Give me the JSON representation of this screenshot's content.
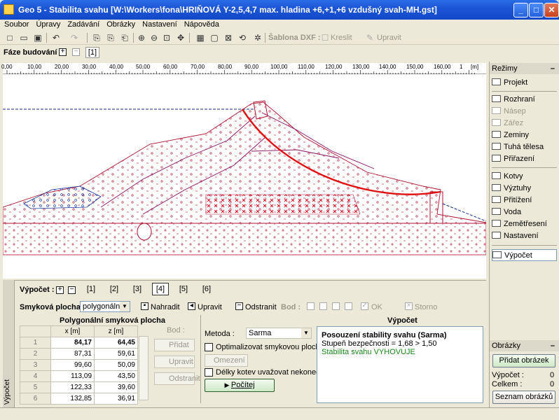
{
  "window": {
    "title": "Geo 5 - Stabilita svahu [W:\\Workers\\fona\\HRIŇOVÁ Y-2,5,4,7 max. hladina +6,+1,+6 vzdušný svah-MH.gst]",
    "controls": [
      "_",
      "□",
      "✕"
    ]
  },
  "menu": [
    "Soubor",
    "Úpravy",
    "Zadávání",
    "Obrázky",
    "Nastavení",
    "Nápověda"
  ],
  "toolbar": {
    "template_label": "Šablona DXF :",
    "draw_label": "Kreslit",
    "edit_label": "Upravit"
  },
  "phase": {
    "label": "Fáze budování :",
    "tab": "[1]"
  },
  "ruler": {
    "ticks": [
      "0,00",
      "10,00",
      "20,00",
      "30,00",
      "40,00",
      "50,00",
      "60,00",
      "70,00",
      "80,00",
      "90,00",
      "100,00",
      "110,00",
      "120,00",
      "130,00",
      "140,00",
      "150,00",
      "160,00",
      "1"
    ],
    "unit": "[m]"
  },
  "calc": {
    "label": "Výpočet :",
    "tabs": [
      "[1]",
      "[2]",
      "[3]",
      "[4]",
      "[5]",
      "[6]"
    ],
    "selected_tab": "[4]",
    "surface_label": "Smyková plocha :",
    "surface_value": "polygonální",
    "buttons": {
      "replace": "Nahradit",
      "edit": "Upravit",
      "remove": "Odstranit"
    },
    "bod_label": "Bod :",
    "ok_label": "OK",
    "cancel_label": "Storno",
    "side_tab": "Výpočet"
  },
  "polygon": {
    "title": "Polygonální smyková plocha",
    "col_x": "x [m]",
    "col_z": "z [m]",
    "rows": [
      {
        "i": "1",
        "x": "84,17",
        "z": "64,45"
      },
      {
        "i": "2",
        "x": "87,31",
        "z": "59,61"
      },
      {
        "i": "3",
        "x": "99,60",
        "z": "50,09"
      },
      {
        "i": "4",
        "x": "113,09",
        "z": "43,50"
      },
      {
        "i": "5",
        "x": "122,33",
        "z": "39,60"
      },
      {
        "i": "6",
        "x": "132,85",
        "z": "36,91"
      }
    ],
    "bod_label": "Bod :",
    "add": "Přidat",
    "edit": "Upravit",
    "remove": "Odstranit"
  },
  "method": {
    "label": "Metoda :",
    "value": "Sarma",
    "optimize": "Optimalizovat smykovou plochu",
    "limits": "Omezení",
    "anchors": "Délky kotev uvažovat nekonečné",
    "compute": "Počítej"
  },
  "result": {
    "header": "Výpočet",
    "title": "Posouzení stability svahu (Sarma)",
    "factor": "Stupeň bezpečnosti = 1,68 > 1,50",
    "verdict": "Stabilita svahu VYHOVUJE"
  },
  "modes": {
    "header": "Režimy",
    "items": [
      {
        "label": "Projekt",
        "state": "normal"
      },
      {
        "label": "Rozhraní",
        "state": "normal"
      },
      {
        "label": "Násep",
        "state": "disabled"
      },
      {
        "label": "Zářez",
        "state": "disabled"
      },
      {
        "label": "Zeminy",
        "state": "normal"
      },
      {
        "label": "Tuhá tělesa",
        "state": "normal"
      },
      {
        "label": "Přiřazení",
        "state": "normal"
      },
      {
        "label": "Kotvy",
        "state": "normal"
      },
      {
        "label": "Výztuhy",
        "state": "normal"
      },
      {
        "label": "Přitížení",
        "state": "normal"
      },
      {
        "label": "Voda",
        "state": "normal"
      },
      {
        "label": "Zemětřesení",
        "state": "normal"
      },
      {
        "label": "Nastavení",
        "state": "normal"
      },
      {
        "label": "Výpočet",
        "state": "selected"
      }
    ]
  },
  "pictures": {
    "header": "Obrázky",
    "add": "Přidat obrázek",
    "calc_label": "Výpočet :",
    "calc_value": "0",
    "total_label": "Celkem :",
    "total_value": "0",
    "list": "Seznam obrázků"
  },
  "colors": {
    "dam": "#b01030",
    "slip": "#e01010",
    "water": "#1a2a8a",
    "titlebar": "#1c56d6"
  }
}
